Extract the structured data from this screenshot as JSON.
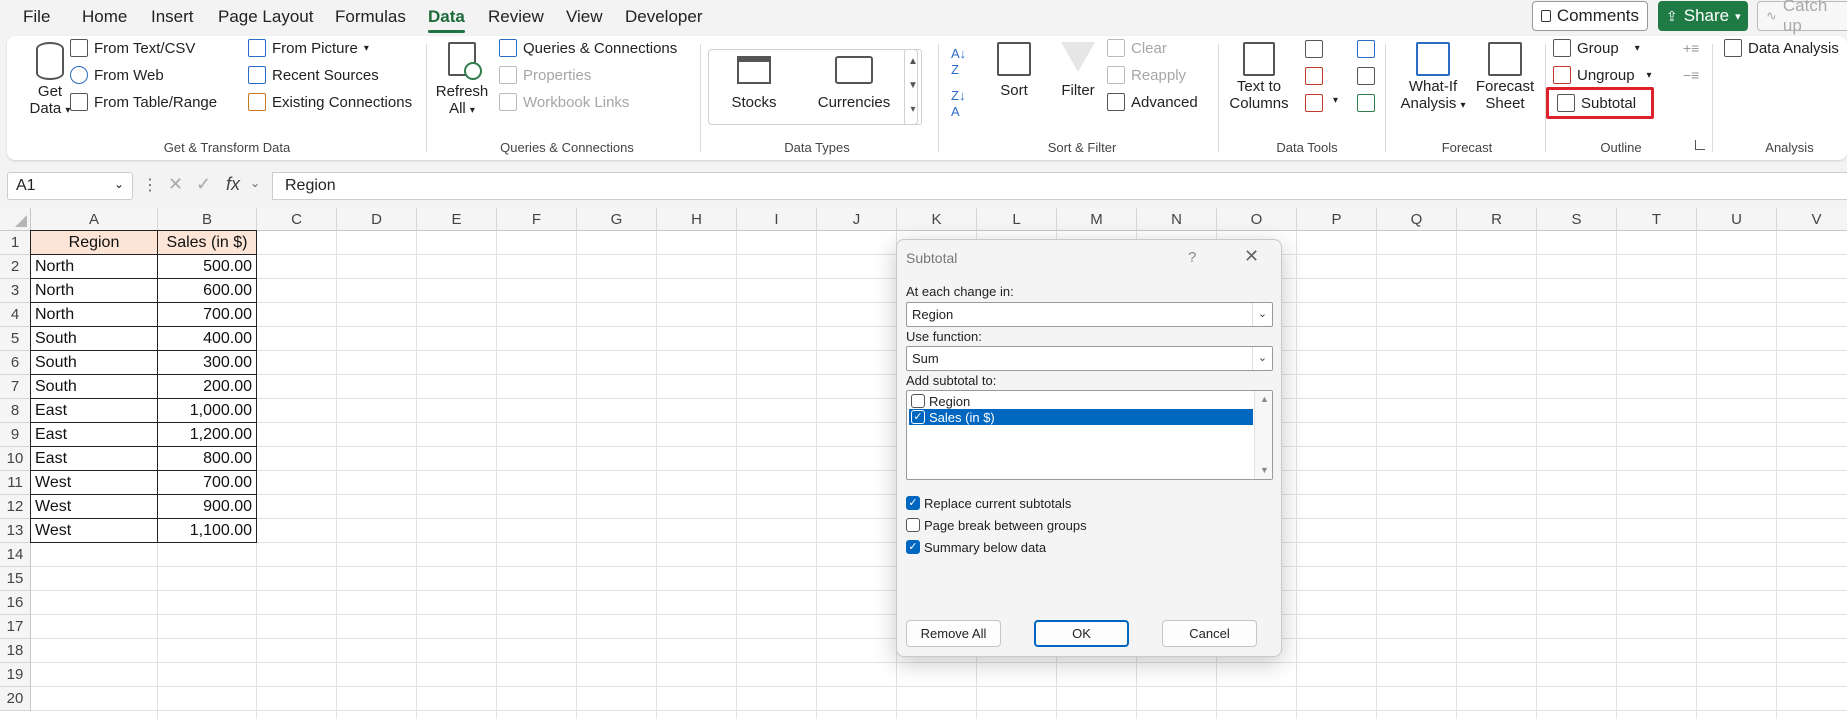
{
  "menu": {
    "tabs": [
      "File",
      "Home",
      "Insert",
      "Page Layout",
      "Formulas",
      "Data",
      "Review",
      "View",
      "Developer"
    ],
    "active_tab": "Data",
    "comments_label": "Comments",
    "share_label": "Share",
    "catchup_label": "Catch up"
  },
  "ribbon": {
    "get_transform": {
      "get_data": "Get",
      "get_data2": "Data",
      "from_text_csv": "From Text/CSV",
      "from_web": "From Web",
      "from_table_range": "From Table/Range",
      "from_picture": "From Picture",
      "recent_sources": "Recent Sources",
      "existing_connections": "Existing Connections",
      "group_label": "Get & Transform Data"
    },
    "queries": {
      "refresh": "Refresh",
      "refresh2": "All",
      "queries_connections": "Queries & Connections",
      "properties": "Properties",
      "workbook_links": "Workbook Links",
      "group_label": "Queries & Connections"
    },
    "data_types": {
      "stocks": "Stocks",
      "currencies": "Currencies",
      "group_label": "Data Types"
    },
    "sort_filter": {
      "sort": "Sort",
      "filter": "Filter",
      "clear": "Clear",
      "reapply": "Reapply",
      "advanced": "Advanced",
      "group_label": "Sort & Filter"
    },
    "data_tools": {
      "text_to_columns": "Text to",
      "text_to_columns2": "Columns",
      "group_label": "Data Tools"
    },
    "forecast": {
      "what_if": "What-If",
      "what_if2": "Analysis",
      "forecast_sheet": "Forecast",
      "forecast_sheet2": "Sheet",
      "group_label": "Forecast"
    },
    "outline": {
      "group": "Group",
      "ungroup": "Ungroup",
      "subtotal": "Subtotal",
      "group_label": "Outline"
    },
    "analysis": {
      "data_analysis": "Data Analysis",
      "group_label": "Analysis"
    },
    "highlight_color": "#e0202a"
  },
  "formula_bar": {
    "name_box": "A1",
    "fx": "fx",
    "content": "Region"
  },
  "sheet": {
    "columns": [
      "A",
      "B",
      "C",
      "D",
      "E",
      "F",
      "G",
      "H",
      "I",
      "J",
      "K",
      "L",
      "M",
      "N",
      "O",
      "P",
      "Q",
      "R",
      "S",
      "T",
      "U",
      "V"
    ],
    "rows": [
      "1",
      "2",
      "3",
      "4",
      "5",
      "6",
      "7",
      "8",
      "9",
      "10",
      "11",
      "12",
      "13",
      "14",
      "15",
      "16",
      "17",
      "18",
      "19",
      "20"
    ],
    "header_a": "Region",
    "header_b": "Sales (in $)",
    "data": [
      {
        "region": "North",
        "sales": "500.00"
      },
      {
        "region": "North",
        "sales": "600.00"
      },
      {
        "region": "North",
        "sales": "700.00"
      },
      {
        "region": "South",
        "sales": "400.00"
      },
      {
        "region": "South",
        "sales": "300.00"
      },
      {
        "region": "South",
        "sales": "200.00"
      },
      {
        "region": "East",
        "sales": "1,000.00"
      },
      {
        "region": "East",
        "sales": "1,200.00"
      },
      {
        "region": "East",
        "sales": "800.00"
      },
      {
        "region": "West",
        "sales": "700.00"
      },
      {
        "region": "West",
        "sales": "900.00"
      },
      {
        "region": "West",
        "sales": "1,100.00"
      }
    ],
    "header_fill": "#fce4d6"
  },
  "dialog": {
    "title": "Subtotal",
    "help": "?",
    "at_each_change_label": "At each change in:",
    "at_each_change_value": "Region",
    "use_function_label": "Use function:",
    "use_function_value": "Sum",
    "add_subtotal_label": "Add subtotal to:",
    "fields": [
      {
        "label": "Region",
        "checked": false
      },
      {
        "label": "Sales (in $)",
        "checked": true
      }
    ],
    "replace_current": "Replace current subtotals",
    "page_break": "Page break between groups",
    "summary_below": "Summary below data",
    "remove_all": "Remove All",
    "ok": "OK",
    "cancel": "Cancel",
    "accent": "#0067c0"
  }
}
